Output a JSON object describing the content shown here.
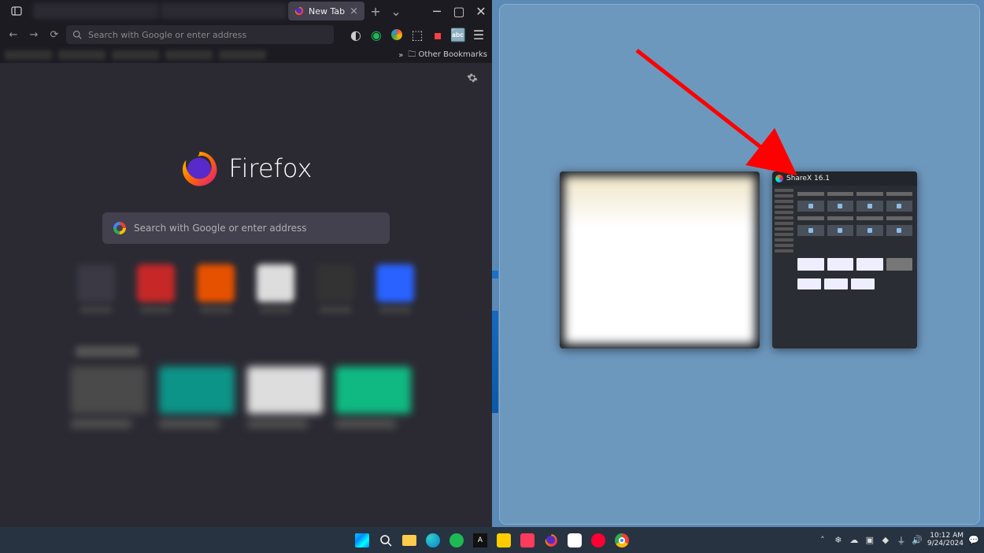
{
  "firefox": {
    "tab": {
      "title": "New Tab"
    },
    "urlbar": {
      "placeholder": "Search with Google or enter address"
    },
    "bookmarks_overflow": "Other Bookmarks",
    "brand": "Firefox",
    "hero_search_placeholder": "Search with Google or enter address"
  },
  "snap_assist": {
    "thumb_b_title": "ShareX 16.1"
  },
  "taskbar": {
    "time": "10:12 AM",
    "date": "9/24/2024"
  }
}
